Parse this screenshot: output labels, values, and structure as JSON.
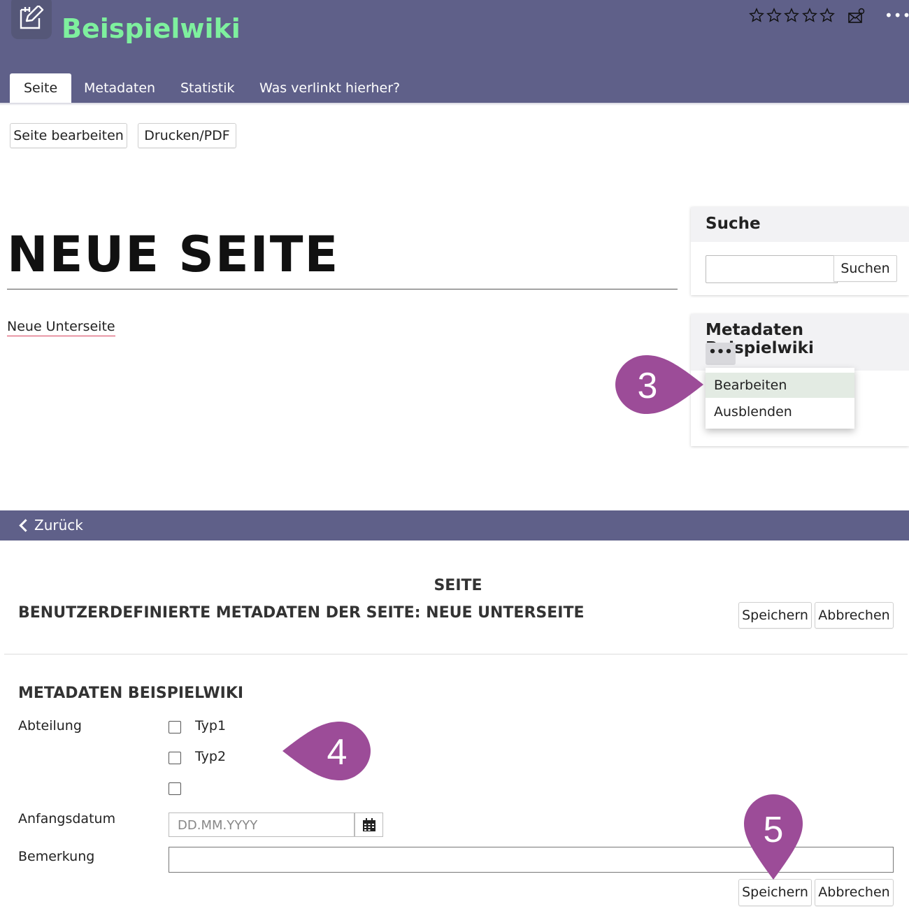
{
  "header": {
    "app_title": "Beispielwiki",
    "logo_icon": "edit-note-icon",
    "rating_icons": [
      "star-icon",
      "star-icon",
      "star-icon",
      "star-icon",
      "star-icon"
    ],
    "mail_icon": "mail-subscribe-icon",
    "more_label": "•••"
  },
  "tabs": [
    {
      "label": "Seite",
      "active": true
    },
    {
      "label": "Metadaten",
      "active": false
    },
    {
      "label": "Statistik",
      "active": false
    },
    {
      "label": "Was verlinkt hierher?",
      "active": false
    }
  ],
  "toolbar": {
    "edit_label": "Seite bearbeiten",
    "print_label": "Drucken/PDF"
  },
  "page": {
    "title": "NEUE SEITE",
    "sub_link": "Neue Unterseite"
  },
  "search": {
    "title": "Suche",
    "input_value": "",
    "button_label": "Suchen"
  },
  "meta_panel": {
    "title": "Metadaten Beispielwiki",
    "more_label": "•••",
    "menu": [
      {
        "label": "Bearbeiten",
        "highlighted": true
      },
      {
        "label": "Ausblenden",
        "highlighted": false
      }
    ]
  },
  "markers": {
    "three": "3",
    "four": "4",
    "five": "5",
    "color": "#9c4c98"
  },
  "back": {
    "label": "Zurück"
  },
  "form": {
    "supertitle": "SEITE",
    "title": "BENUTZERDEFINIERTE METADATEN DER SEITE: NEUE UNTERSEITE",
    "save_label": "Speichern",
    "cancel_label": "Abbrechen",
    "section_title": "METADATEN BEISPIELWIKI",
    "department_label": "Abteilung",
    "options": [
      {
        "label": "Typ1",
        "checked": false
      },
      {
        "label": "Typ2",
        "checked": false
      },
      {
        "label": "",
        "checked": false
      }
    ],
    "start_date_label": "Anfangsdatum",
    "start_date_placeholder": "DD.MM.YYYY",
    "remark_label": "Bemerkung",
    "remark_value": ""
  },
  "colors": {
    "header_bg": "#5f6089",
    "brand_green": "#7ef09e",
    "menu_highlight": "#e3ebe3",
    "marker": "#9c4c98"
  }
}
